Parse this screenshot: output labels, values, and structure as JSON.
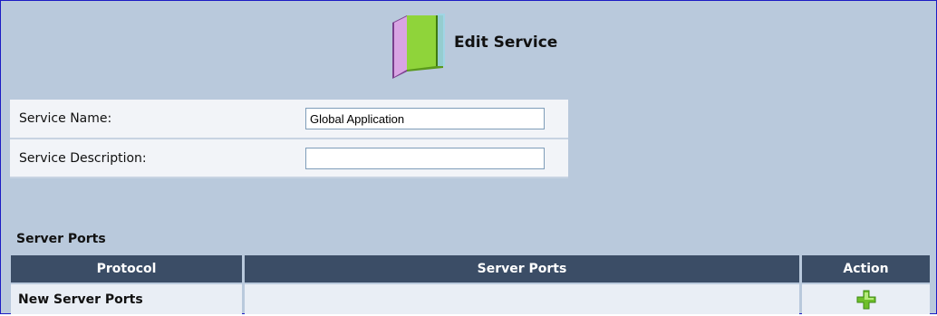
{
  "header": {
    "title": "Edit Service",
    "icon": "book-icon"
  },
  "form": {
    "service_name_label": "Service Name:",
    "service_name_value": "Global Application",
    "service_description_label": "Service Description:",
    "service_description_value": ""
  },
  "server_ports": {
    "section_title": "Server Ports",
    "columns": [
      "Protocol",
      "Server Ports",
      "Action"
    ],
    "rows": [
      {
        "protocol": "New Server Ports",
        "server_ports": "",
        "action_icon": "add-icon"
      }
    ]
  },
  "colors": {
    "page_background": "#b9c9dc",
    "table_header": "#3b4d66",
    "add_icon": "#6fbf2a"
  }
}
